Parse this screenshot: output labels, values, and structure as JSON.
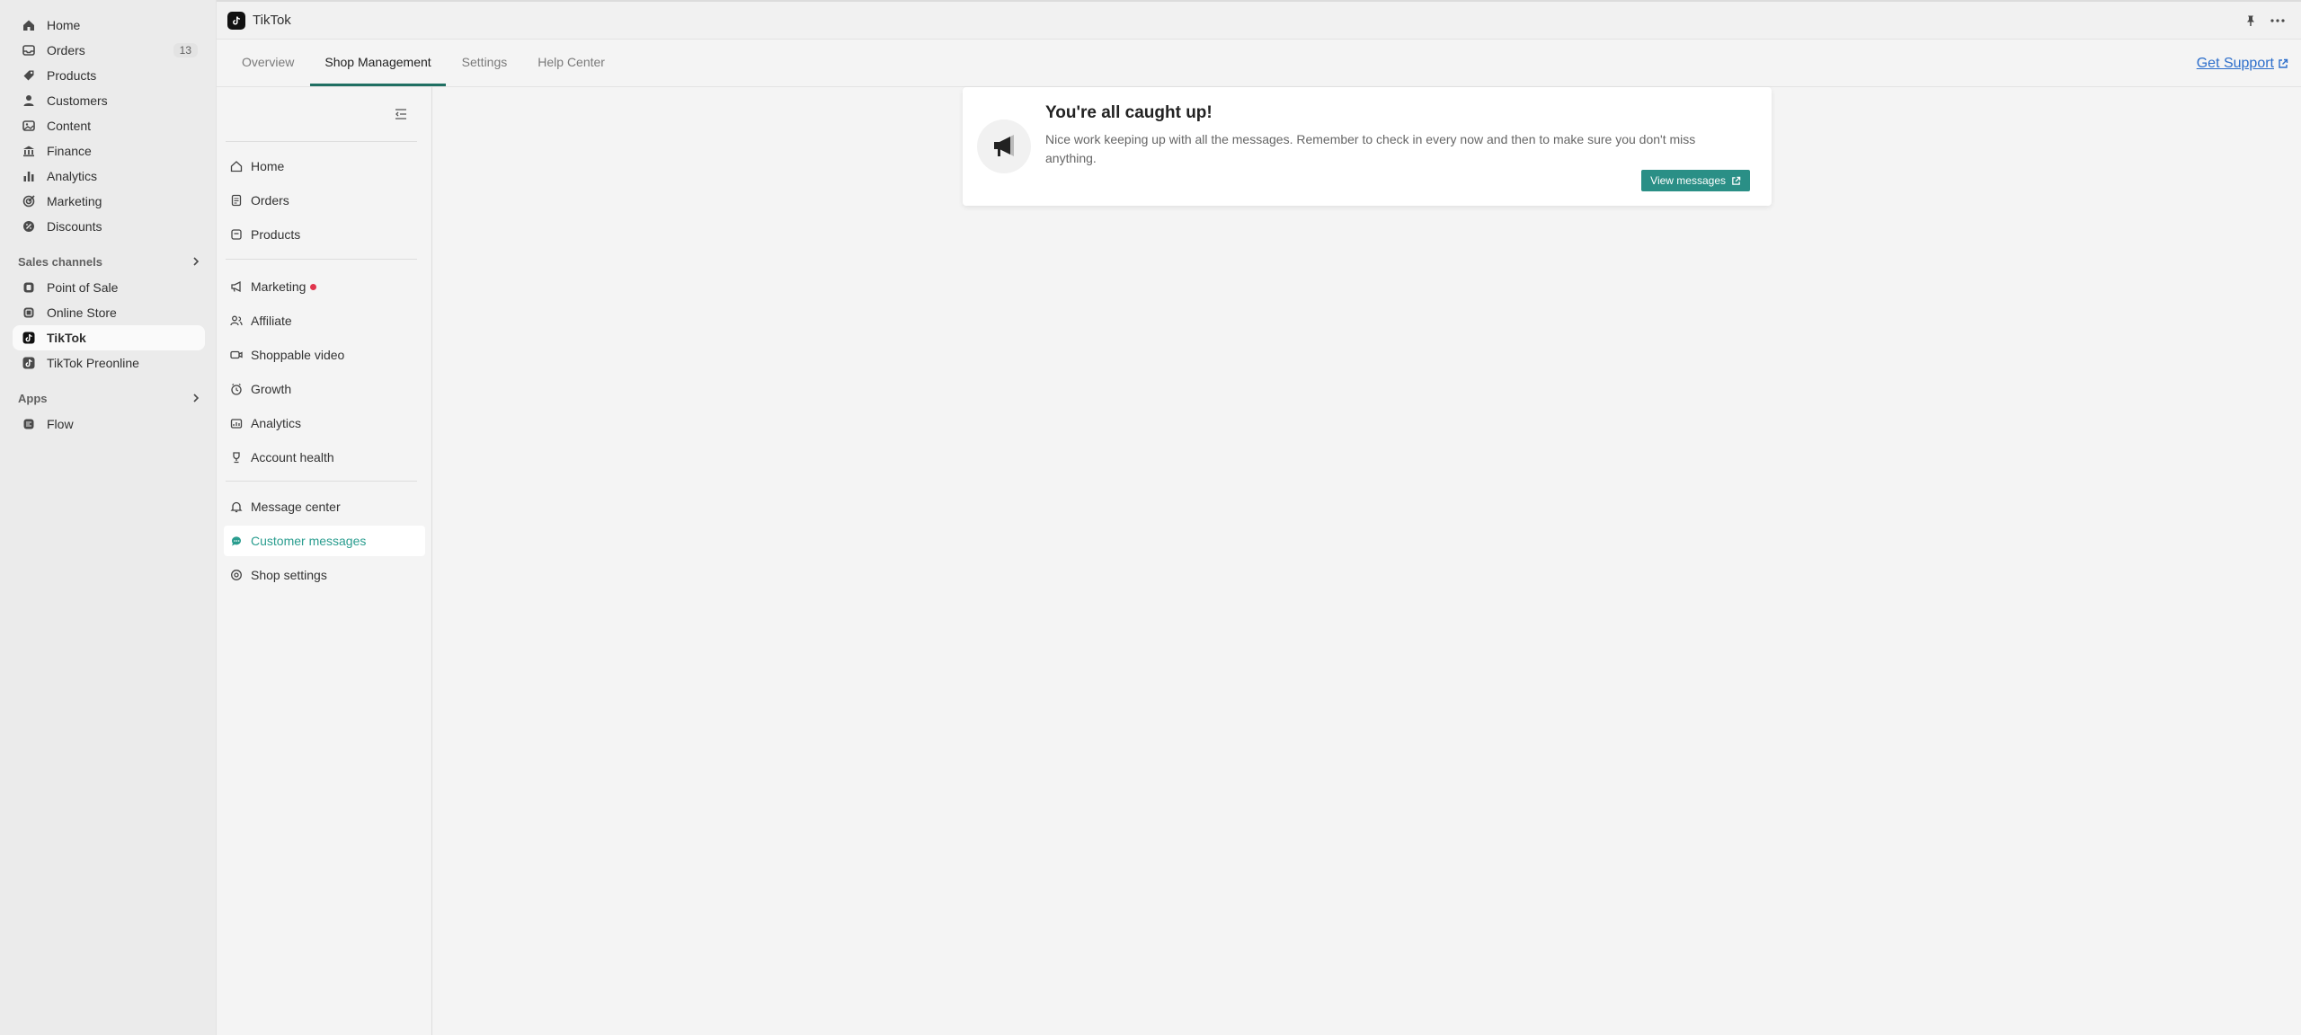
{
  "admin_nav": {
    "items": [
      {
        "label": "Home",
        "icon": "home-icon"
      },
      {
        "label": "Orders",
        "icon": "inbox-icon",
        "count": "13"
      },
      {
        "label": "Products",
        "icon": "tag-icon"
      },
      {
        "label": "Customers",
        "icon": "person-icon"
      },
      {
        "label": "Content",
        "icon": "image-icon"
      },
      {
        "label": "Finance",
        "icon": "bank-icon"
      },
      {
        "label": "Analytics",
        "icon": "bar-chart-icon"
      },
      {
        "label": "Marketing",
        "icon": "target-icon"
      },
      {
        "label": "Discounts",
        "icon": "discount-icon"
      }
    ],
    "sales_channels_heading": "Sales channels",
    "sales_channels": [
      {
        "label": "Point of Sale",
        "icon": "pos-icon"
      },
      {
        "label": "Online Store",
        "icon": "store-icon"
      },
      {
        "label": "TikTok",
        "icon": "tiktok-icon",
        "active": true
      },
      {
        "label": "TikTok Preonline",
        "icon": "tiktok-icon"
      }
    ],
    "apps_heading": "Apps",
    "apps": [
      {
        "label": "Flow",
        "icon": "flow-icon"
      }
    ]
  },
  "app": {
    "title": "TikTok",
    "tabs": [
      "Overview",
      "Shop Management",
      "Settings",
      "Help Center"
    ],
    "active_tab": "Shop Management",
    "get_support": "Get Support"
  },
  "inner_nav": {
    "groups": [
      [
        {
          "label": "Home",
          "icon": "home-icon"
        },
        {
          "label": "Orders",
          "icon": "clipboard-icon"
        },
        {
          "label": "Products",
          "icon": "box-icon"
        }
      ],
      [
        {
          "label": "Marketing",
          "icon": "megaphone-icon",
          "dot": true
        },
        {
          "label": "Affiliate",
          "icon": "people-icon"
        },
        {
          "label": "Shoppable video",
          "icon": "video-icon"
        },
        {
          "label": "Growth",
          "icon": "clock-icon"
        },
        {
          "label": "Analytics",
          "icon": "analytics-icon"
        },
        {
          "label": "Account health",
          "icon": "trophy-icon"
        }
      ],
      [
        {
          "label": "Message center",
          "icon": "bell-icon"
        },
        {
          "label": "Customer messages",
          "icon": "chat-icon",
          "selected": true
        },
        {
          "label": "Shop settings",
          "icon": "settings-icon"
        }
      ]
    ]
  },
  "card": {
    "title": "You're all caught up!",
    "description": "Nice work keeping up with all the messages. Remember to check in every now and then to make sure you don't miss anything.",
    "button": "View messages"
  },
  "colors": {
    "accent_teal": "#2a8f86",
    "tab_underline": "#1f6f62",
    "link_blue": "#2c6ecb",
    "notification_red": "#e0344c"
  }
}
